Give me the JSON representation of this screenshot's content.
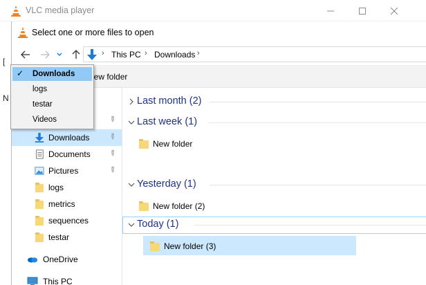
{
  "vlc": {
    "title": "VLC media player",
    "left_glyphs": [
      "[",
      "N"
    ]
  },
  "dialog": {
    "title": "Select one or more files to open",
    "breadcrumb": [
      "This PC",
      "Downloads"
    ],
    "new_folder_label": "New folder"
  },
  "history_popup": {
    "items": [
      {
        "label": "Downloads",
        "checked": true
      },
      {
        "label": "logs",
        "checked": false
      },
      {
        "label": "testar",
        "checked": false
      },
      {
        "label": "Videos",
        "checked": false
      }
    ]
  },
  "navpane": {
    "items": [
      {
        "label": "Downloads",
        "icon": "download-arrow-icon",
        "pinned": true
      },
      {
        "label": "Documents",
        "icon": "documents-icon",
        "pinned": true
      },
      {
        "label": "Pictures",
        "icon": "pictures-icon",
        "pinned": true
      },
      {
        "label": "logs",
        "icon": "folder-icon",
        "pinned": false
      },
      {
        "label": "metrics",
        "icon": "folder-icon",
        "pinned": false
      },
      {
        "label": "sequences",
        "icon": "folder-icon",
        "pinned": false
      },
      {
        "label": "testar",
        "icon": "folder-icon",
        "pinned": false
      },
      {
        "label": "OneDrive",
        "icon": "onedrive-cloud-icon",
        "pinned": false
      },
      {
        "label": "This PC",
        "icon": "this-pc-icon",
        "pinned": false
      }
    ]
  },
  "content": {
    "groups": [
      {
        "label": "Last month (2)",
        "expanded": false,
        "files": []
      },
      {
        "label": "Last week (1)",
        "expanded": true,
        "files": [
          "New folder"
        ]
      },
      {
        "label": "Yesterday (1)",
        "expanded": true,
        "files": [
          "New folder (2)"
        ]
      },
      {
        "label": "Today (1)",
        "expanded": true,
        "files": [
          "New folder (3)"
        ]
      }
    ]
  },
  "colors": {
    "accent": "#0078d7",
    "selection": "#cce8ff",
    "group_header_text": "#1e3287",
    "folder": "#f8d775"
  }
}
